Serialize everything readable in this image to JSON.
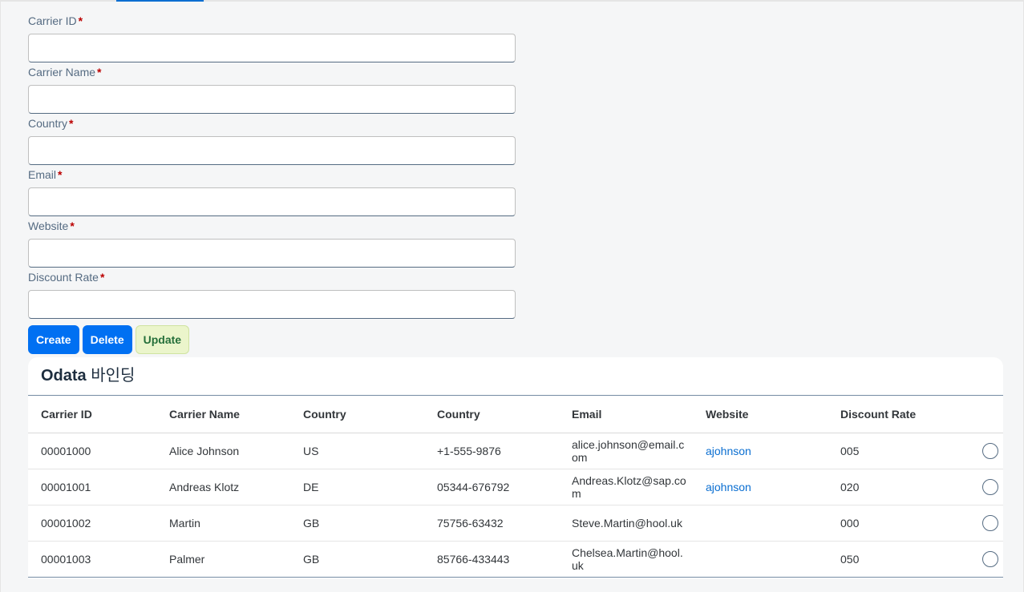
{
  "form": {
    "fields": [
      {
        "label": "Carrier ID",
        "value": "",
        "required": true
      },
      {
        "label": "Carrier Name",
        "value": "",
        "required": true
      },
      {
        "label": "Country",
        "value": "",
        "required": true
      },
      {
        "label": "Email",
        "value": "",
        "required": true
      },
      {
        "label": "Website",
        "value": "",
        "required": true
      },
      {
        "label": "Discount Rate",
        "value": "",
        "required": true
      }
    ],
    "required_mark": "*"
  },
  "buttons": {
    "create": "Create",
    "delete": "Delete",
    "update": "Update"
  },
  "table": {
    "title_bold": "Odata",
    "title_rest": " 바인딩",
    "columns": [
      "Carrier ID",
      "Carrier Name",
      "Country",
      "Country",
      "Email",
      "Website",
      "Discount Rate"
    ],
    "rows": [
      {
        "id": "00001000",
        "name": "Alice Johnson",
        "country": "US",
        "phone": "+1-555-9876",
        "email": "alice.johnson@email.com",
        "website": "ajohnson",
        "discount": "005"
      },
      {
        "id": "00001001",
        "name": "Andreas Klotz",
        "country": "DE",
        "phone": "05344-676792",
        "email": "Andreas.Klotz@sap.com",
        "website": "ajohnson",
        "discount": "020"
      },
      {
        "id": "00001002",
        "name": "Martin",
        "country": "GB",
        "phone": "75756-63432",
        "email": "Steve.Martin@hool.uk",
        "website": "",
        "discount": "000"
      },
      {
        "id": "00001003",
        "name": "Palmer",
        "country": "GB",
        "phone": "85766-433443",
        "email": "Chelsea.Martin@hool.uk",
        "website": "",
        "discount": "050"
      }
    ]
  },
  "colors": {
    "accent": "#0a6ed1",
    "primary_button": "#0070f2",
    "success_button_bg": "#ebf5cb",
    "required": "#bb0000"
  }
}
